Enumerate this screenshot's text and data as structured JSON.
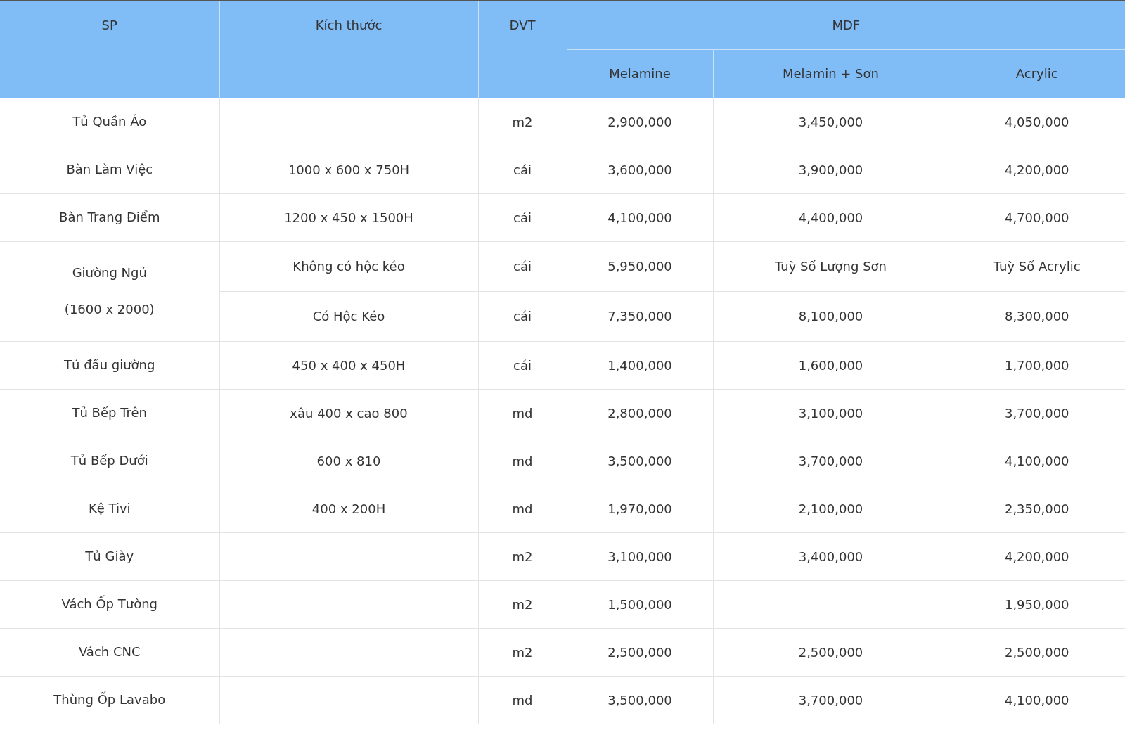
{
  "table": {
    "columns": [
      {
        "label": "SP"
      },
      {
        "label": "Kích thước"
      },
      {
        "label": "ĐVT"
      },
      {
        "label": "MDF",
        "children": [
          "Melamine",
          "Melamin + Sơn",
          "Acrylic"
        ]
      }
    ],
    "rows": [
      {
        "product": [
          "Tủ Quần Áo"
        ],
        "variants": [
          {
            "unit": "m2",
            "prices": {
              "melamine": "2,900,000",
              "melamin_son": "3,450,000",
              "acrylic": "4,050,000"
            }
          }
        ]
      },
      {
        "product": [
          "Bàn Làm Việc"
        ],
        "variants": [
          {
            "size": "1000 x 600 x 750H",
            "unit": "cái",
            "prices": {
              "melamine": "3,600,000",
              "melamin_son": "3,900,000",
              "acrylic": "4,200,000"
            }
          }
        ]
      },
      {
        "product": [
          "Bàn Trang Điểm"
        ],
        "variants": [
          {
            "size": "1200 x 450 x 1500H",
            "unit": "cái",
            "prices": {
              "melamine": "4,100,000",
              "melamin_son": "4,400,000",
              "acrylic": "4,700,000"
            }
          }
        ]
      },
      {
        "product": [
          "Giường Ngủ",
          "(1600 x 2000)"
        ],
        "variants": [
          {
            "size": "Không có hộc kéo",
            "unit": "cái",
            "prices": {
              "melamine": "5,950,000",
              "melamin_son": "Tuỳ Số Lượng Sơn",
              "acrylic": "Tuỳ Số Acrylic"
            }
          },
          {
            "size": "Có Hộc Kéo",
            "unit": "cái",
            "prices": {
              "melamine": "7,350,000",
              "melamin_son": "8,100,000",
              "acrylic": "8,300,000"
            }
          }
        ]
      },
      {
        "product": [
          "Tủ đầu giường"
        ],
        "variants": [
          {
            "size": "450 x 400 x 450H",
            "unit": "cái",
            "prices": {
              "melamine": "1,400,000",
              "melamin_son": "1,600,000",
              "acrylic": "1,700,000"
            }
          }
        ]
      },
      {
        "product": [
          "Tủ Bếp Trên"
        ],
        "variants": [
          {
            "size": "xâu 400 x cao 800",
            "unit": "md",
            "prices": {
              "melamine": "2,800,000",
              "melamin_son": "3,100,000",
              "acrylic": "3,700,000"
            }
          }
        ]
      },
      {
        "product": [
          "Tủ Bếp Dưới"
        ],
        "variants": [
          {
            "size": "600 x 810",
            "unit": "md",
            "prices": {
              "melamine": "3,500,000",
              "melamin_son": "3,700,000",
              "acrylic": "4,100,000"
            }
          }
        ]
      },
      {
        "product": [
          "Kệ Tivi"
        ],
        "variants": [
          {
            "size": "400 x 200H",
            "unit": "md",
            "prices": {
              "melamine": "1,970,000",
              "melamin_son": "2,100,000",
              "acrylic": "2,350,000"
            }
          }
        ]
      },
      {
        "product": [
          "Tủ Giày"
        ],
        "variants": [
          {
            "unit": "m2",
            "prices": {
              "melamine": "3,100,000",
              "melamin_son": "3,400,000",
              "acrylic": "4,200,000"
            }
          }
        ]
      },
      {
        "product": [
          "Vách Ốp Tường"
        ],
        "variants": [
          {
            "unit": "m2",
            "prices": {
              "melamine": "1,500,000",
              "acrylic": "1,950,000"
            }
          }
        ]
      },
      {
        "product": [
          "Vách CNC"
        ],
        "variants": [
          {
            "unit": "m2",
            "prices": {
              "melamine": "2,500,000",
              "melamin_son": "2,500,000",
              "acrylic": "2,500,000"
            }
          }
        ]
      },
      {
        "product": [
          "Thùng Ốp Lavabo"
        ],
        "variants": [
          {
            "unit": "md",
            "prices": {
              "melamine": "3,500,000",
              "melamin_son": "3,700,000",
              "acrylic": "4,100,000"
            }
          }
        ]
      }
    ]
  }
}
